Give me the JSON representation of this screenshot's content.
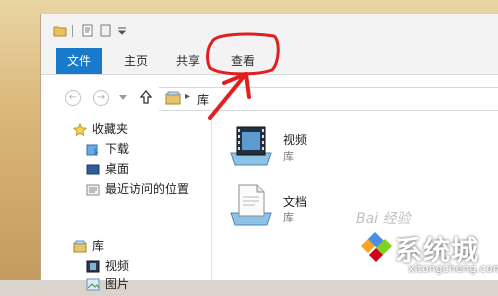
{
  "ribbon": {
    "tabs": [
      "文件",
      "主页",
      "共享",
      "查看"
    ]
  },
  "address": {
    "path": "库"
  },
  "nav": {
    "favorites_label": "收藏夹",
    "favorites": [
      "下载",
      "桌面",
      "最近访问的位置"
    ],
    "libraries_label": "库",
    "libraries": [
      "视频",
      "图片"
    ]
  },
  "content": {
    "items": [
      {
        "name": "视频",
        "sub": "库"
      },
      {
        "name": "文档",
        "sub": "库"
      }
    ]
  },
  "watermark": {
    "brand": "系统城",
    "url": "xitongcheng.com",
    "baidu": "Bai 经验"
  },
  "colors": {
    "file_tab": "#1979ca",
    "annotation": "#e02020"
  }
}
